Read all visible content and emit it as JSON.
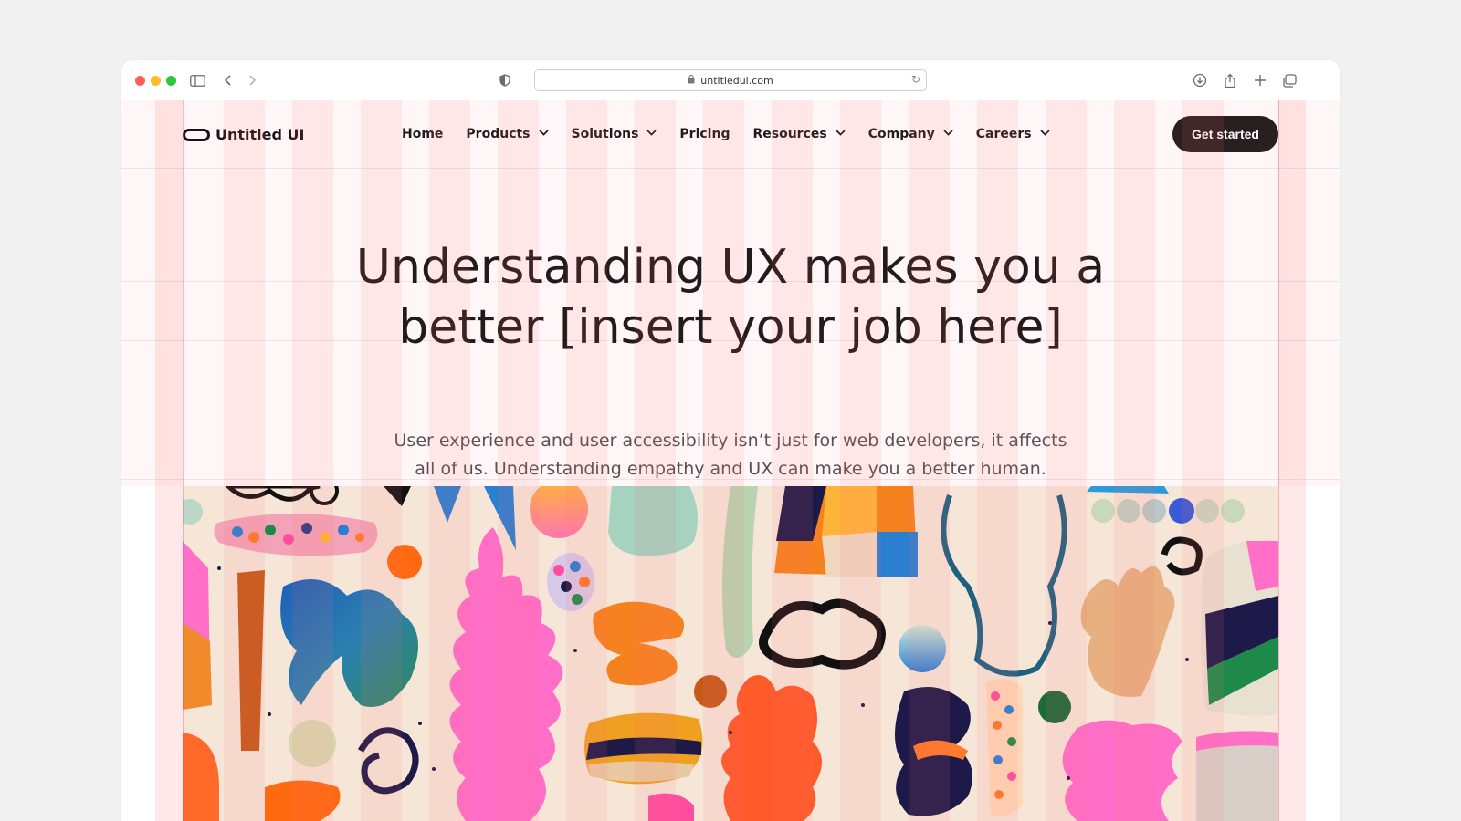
{
  "browser": {
    "url": "untitledui.com"
  },
  "nav": {
    "logo_text": "Untitled UI",
    "items": [
      {
        "label": "Home",
        "dropdown": false
      },
      {
        "label": "Products",
        "dropdown": true
      },
      {
        "label": "Solutions",
        "dropdown": true
      },
      {
        "label": "Pricing",
        "dropdown": false
      },
      {
        "label": "Resources",
        "dropdown": true
      },
      {
        "label": "Company",
        "dropdown": true
      },
      {
        "label": "Careers",
        "dropdown": true
      }
    ],
    "cta_label": "Get started"
  },
  "hero": {
    "title_line1": "Understanding UX makes you a",
    "title_line2": "better [insert your job here]",
    "subtitle_line1": "User experience and user accessibility isn’t just for web developers, it affects",
    "subtitle_line2": "all of us. Understanding empathy and UX can make you a better human."
  },
  "icons": {
    "sidebar": "sidebar-icon",
    "back": "chevron-left-icon",
    "forward": "chevron-right-icon",
    "privacy": "shield-icon",
    "lock": "lock-icon",
    "reload": "reload-icon",
    "download": "download-icon",
    "share": "share-icon",
    "new_tab": "plus-icon",
    "tabs": "tabs-icon"
  },
  "colors": {
    "cta_bg": "#2a1f1f",
    "text_primary": "#231a1a",
    "text_secondary": "#5a5050",
    "hero_bg": "#fff7f7",
    "art_bg": "#f6e6d8"
  }
}
